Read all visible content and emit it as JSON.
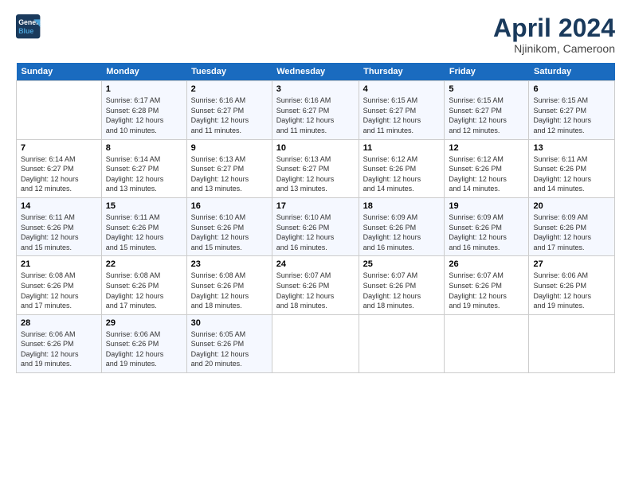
{
  "logo": {
    "line1": "General",
    "line2": "Blue"
  },
  "title": "April 2024",
  "subtitle": "Njinikom, Cameroon",
  "headers": [
    "Sunday",
    "Monday",
    "Tuesday",
    "Wednesday",
    "Thursday",
    "Friday",
    "Saturday"
  ],
  "weeks": [
    [
      {
        "day": "",
        "info": ""
      },
      {
        "day": "1",
        "info": "Sunrise: 6:17 AM\nSunset: 6:28 PM\nDaylight: 12 hours\nand 10 minutes."
      },
      {
        "day": "2",
        "info": "Sunrise: 6:16 AM\nSunset: 6:27 PM\nDaylight: 12 hours\nand 11 minutes."
      },
      {
        "day": "3",
        "info": "Sunrise: 6:16 AM\nSunset: 6:27 PM\nDaylight: 12 hours\nand 11 minutes."
      },
      {
        "day": "4",
        "info": "Sunrise: 6:15 AM\nSunset: 6:27 PM\nDaylight: 12 hours\nand 11 minutes."
      },
      {
        "day": "5",
        "info": "Sunrise: 6:15 AM\nSunset: 6:27 PM\nDaylight: 12 hours\nand 12 minutes."
      },
      {
        "day": "6",
        "info": "Sunrise: 6:15 AM\nSunset: 6:27 PM\nDaylight: 12 hours\nand 12 minutes."
      }
    ],
    [
      {
        "day": "7",
        "info": "Sunrise: 6:14 AM\nSunset: 6:27 PM\nDaylight: 12 hours\nand 12 minutes."
      },
      {
        "day": "8",
        "info": "Sunrise: 6:14 AM\nSunset: 6:27 PM\nDaylight: 12 hours\nand 13 minutes."
      },
      {
        "day": "9",
        "info": "Sunrise: 6:13 AM\nSunset: 6:27 PM\nDaylight: 12 hours\nand 13 minutes."
      },
      {
        "day": "10",
        "info": "Sunrise: 6:13 AM\nSunset: 6:27 PM\nDaylight: 12 hours\nand 13 minutes."
      },
      {
        "day": "11",
        "info": "Sunrise: 6:12 AM\nSunset: 6:26 PM\nDaylight: 12 hours\nand 14 minutes."
      },
      {
        "day": "12",
        "info": "Sunrise: 6:12 AM\nSunset: 6:26 PM\nDaylight: 12 hours\nand 14 minutes."
      },
      {
        "day": "13",
        "info": "Sunrise: 6:11 AM\nSunset: 6:26 PM\nDaylight: 12 hours\nand 14 minutes."
      }
    ],
    [
      {
        "day": "14",
        "info": "Sunrise: 6:11 AM\nSunset: 6:26 PM\nDaylight: 12 hours\nand 15 minutes."
      },
      {
        "day": "15",
        "info": "Sunrise: 6:11 AM\nSunset: 6:26 PM\nDaylight: 12 hours\nand 15 minutes."
      },
      {
        "day": "16",
        "info": "Sunrise: 6:10 AM\nSunset: 6:26 PM\nDaylight: 12 hours\nand 15 minutes."
      },
      {
        "day": "17",
        "info": "Sunrise: 6:10 AM\nSunset: 6:26 PM\nDaylight: 12 hours\nand 16 minutes."
      },
      {
        "day": "18",
        "info": "Sunrise: 6:09 AM\nSunset: 6:26 PM\nDaylight: 12 hours\nand 16 minutes."
      },
      {
        "day": "19",
        "info": "Sunrise: 6:09 AM\nSunset: 6:26 PM\nDaylight: 12 hours\nand 16 minutes."
      },
      {
        "day": "20",
        "info": "Sunrise: 6:09 AM\nSunset: 6:26 PM\nDaylight: 12 hours\nand 17 minutes."
      }
    ],
    [
      {
        "day": "21",
        "info": "Sunrise: 6:08 AM\nSunset: 6:26 PM\nDaylight: 12 hours\nand 17 minutes."
      },
      {
        "day": "22",
        "info": "Sunrise: 6:08 AM\nSunset: 6:26 PM\nDaylight: 12 hours\nand 17 minutes."
      },
      {
        "day": "23",
        "info": "Sunrise: 6:08 AM\nSunset: 6:26 PM\nDaylight: 12 hours\nand 18 minutes."
      },
      {
        "day": "24",
        "info": "Sunrise: 6:07 AM\nSunset: 6:26 PM\nDaylight: 12 hours\nand 18 minutes."
      },
      {
        "day": "25",
        "info": "Sunrise: 6:07 AM\nSunset: 6:26 PM\nDaylight: 12 hours\nand 18 minutes."
      },
      {
        "day": "26",
        "info": "Sunrise: 6:07 AM\nSunset: 6:26 PM\nDaylight: 12 hours\nand 19 minutes."
      },
      {
        "day": "27",
        "info": "Sunrise: 6:06 AM\nSunset: 6:26 PM\nDaylight: 12 hours\nand 19 minutes."
      }
    ],
    [
      {
        "day": "28",
        "info": "Sunrise: 6:06 AM\nSunset: 6:26 PM\nDaylight: 12 hours\nand 19 minutes."
      },
      {
        "day": "29",
        "info": "Sunrise: 6:06 AM\nSunset: 6:26 PM\nDaylight: 12 hours\nand 19 minutes."
      },
      {
        "day": "30",
        "info": "Sunrise: 6:05 AM\nSunset: 6:26 PM\nDaylight: 12 hours\nand 20 minutes."
      },
      {
        "day": "",
        "info": ""
      },
      {
        "day": "",
        "info": ""
      },
      {
        "day": "",
        "info": ""
      },
      {
        "day": "",
        "info": ""
      }
    ]
  ]
}
